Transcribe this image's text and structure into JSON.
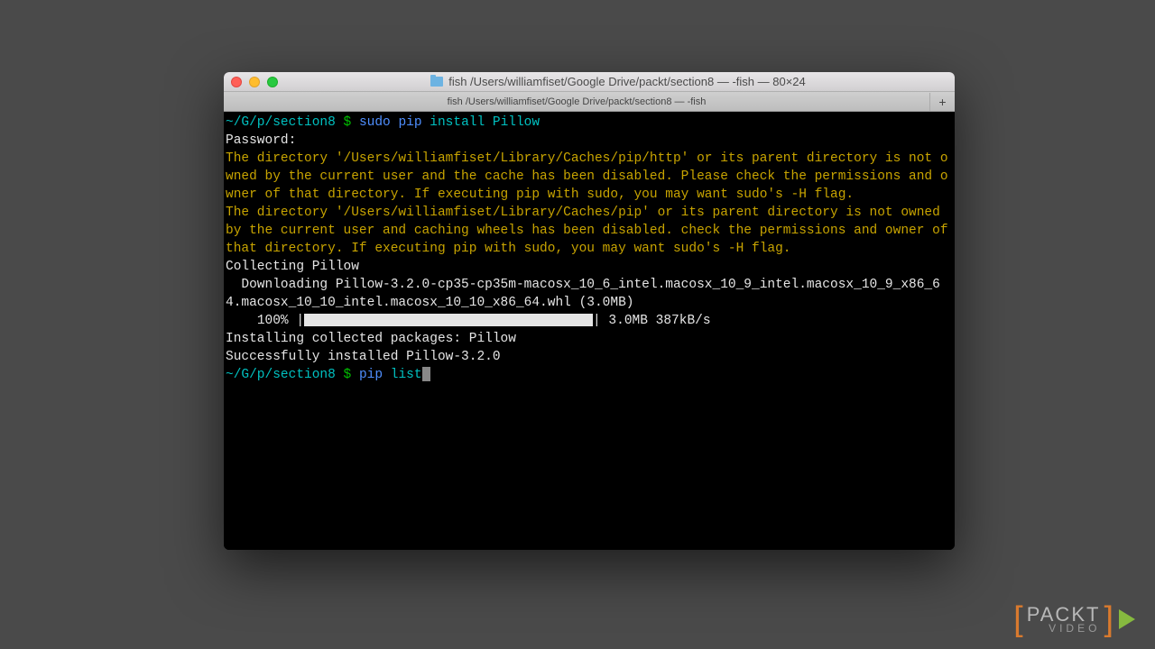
{
  "window": {
    "title": "fish  /Users/williamfiset/Google Drive/packt/section8 — -fish — 80×24",
    "tab": "fish  /Users/williamfiset/Google Drive/packt/section8 — -fish"
  },
  "prompt": {
    "path": "~/G/p/section8",
    "symbol": "$"
  },
  "cmd1": {
    "sudo": "sudo",
    "pip": "pip",
    "rest": "install Pillow"
  },
  "lines": {
    "password": "Password:",
    "warn1": "The directory '/Users/williamfiset/Library/Caches/pip/http' or its parent directory is not owned by the current user and the cache has been disabled. Please check the permissions and owner of that directory. If executing pip with sudo, you may want sudo's -H flag.",
    "warn2": "The directory '/Users/williamfiset/Library/Caches/pip' or its parent directory is not owned by the current user and caching wheels has been disabled. check the permissions and owner of that directory. If executing pip with sudo, you may want sudo's -H flag.",
    "collect": "Collecting Pillow",
    "download": "  Downloading Pillow-3.2.0-cp35-cp35m-macosx_10_6_intel.macosx_10_9_intel.macosx_10_9_x86_64.macosx_10_10_intel.macosx_10_10_x86_64.whl (3.0MB)",
    "progress_pct": "    100% |",
    "progress_after": "| 3.0MB 387kB/s",
    "install": "Installing collected packages: Pillow",
    "success": "Successfully installed Pillow-3.2.0"
  },
  "cmd2": {
    "pip": "pip",
    "list": "list"
  },
  "logo": {
    "top": "PACKT",
    "bot": "VIDEO"
  }
}
